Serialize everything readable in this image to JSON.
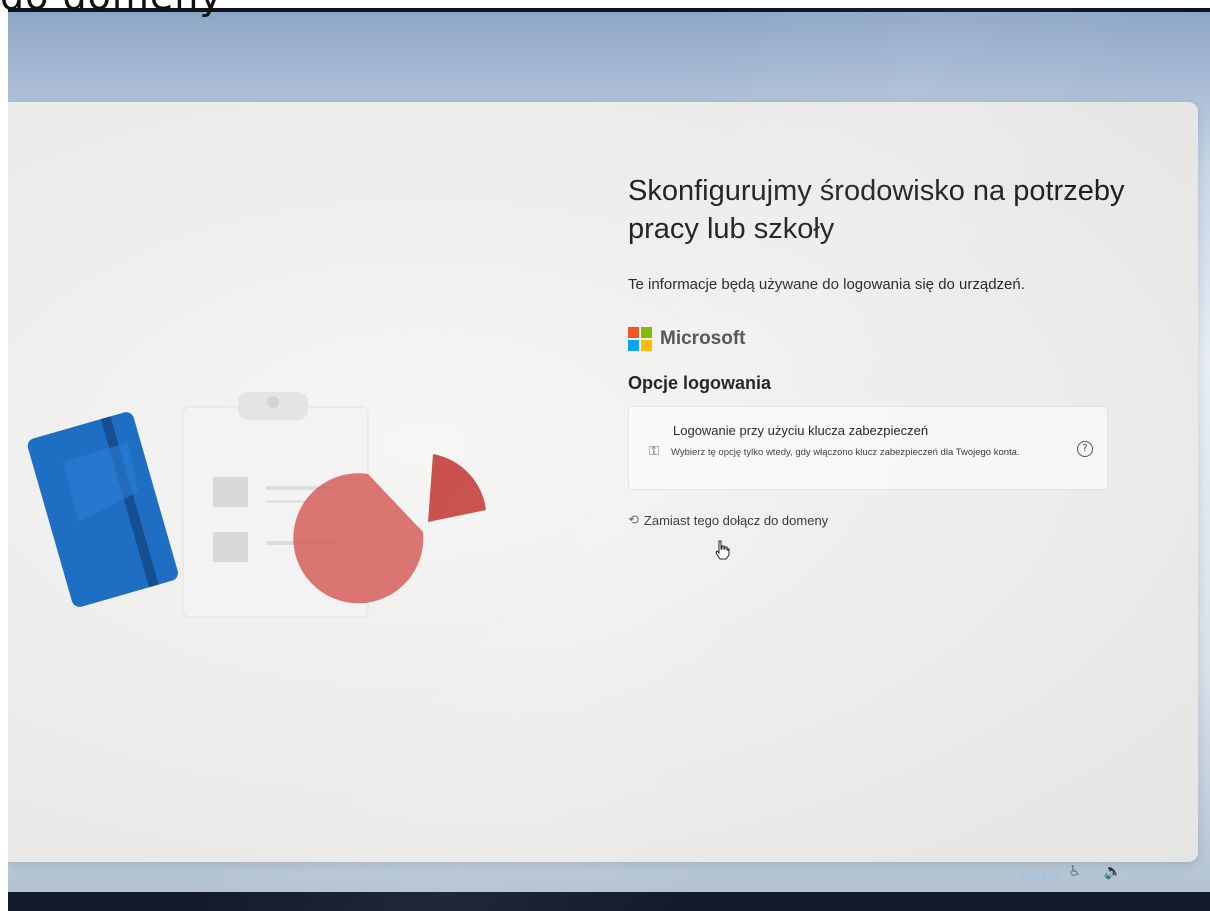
{
  "photo_caption": "do domeny",
  "oobe": {
    "title": "Skonfigurujmy środowisko na potrzeby pracy lub szkoły",
    "subtitle": "Te informacje będą używane do logowania się do urządzeń.",
    "brand": {
      "name": "Microsoft",
      "logo_colors": [
        "#f25022",
        "#7fba00",
        "#00a4ef",
        "#ffb900"
      ]
    },
    "section_title": "Opcje logowania",
    "security_key_option": {
      "title": "Logowanie przy użyciu klucza zabezpieczeń",
      "description": "Wybierz tę opcję tylko wtedy, gdy włączono klucz zabezpieczeń dla Twojego konta.",
      "icon": "security-key-icon",
      "help_icon": "help-icon",
      "help_glyph": "?"
    },
    "domain_join_link": {
      "label": "Zamiast tego dołącz do domeny",
      "icon": "domain-icon"
    },
    "back_button": "Wstecz"
  },
  "tray": {
    "icons": [
      "accessibility-icon",
      "volume-icon"
    ],
    "glyphs": [
      "♿",
      "🔊"
    ]
  },
  "colors": {
    "notebook_blue": "#1e6fc4",
    "pie_red": "#d65e5b",
    "back_link": "#9fc1dc"
  }
}
